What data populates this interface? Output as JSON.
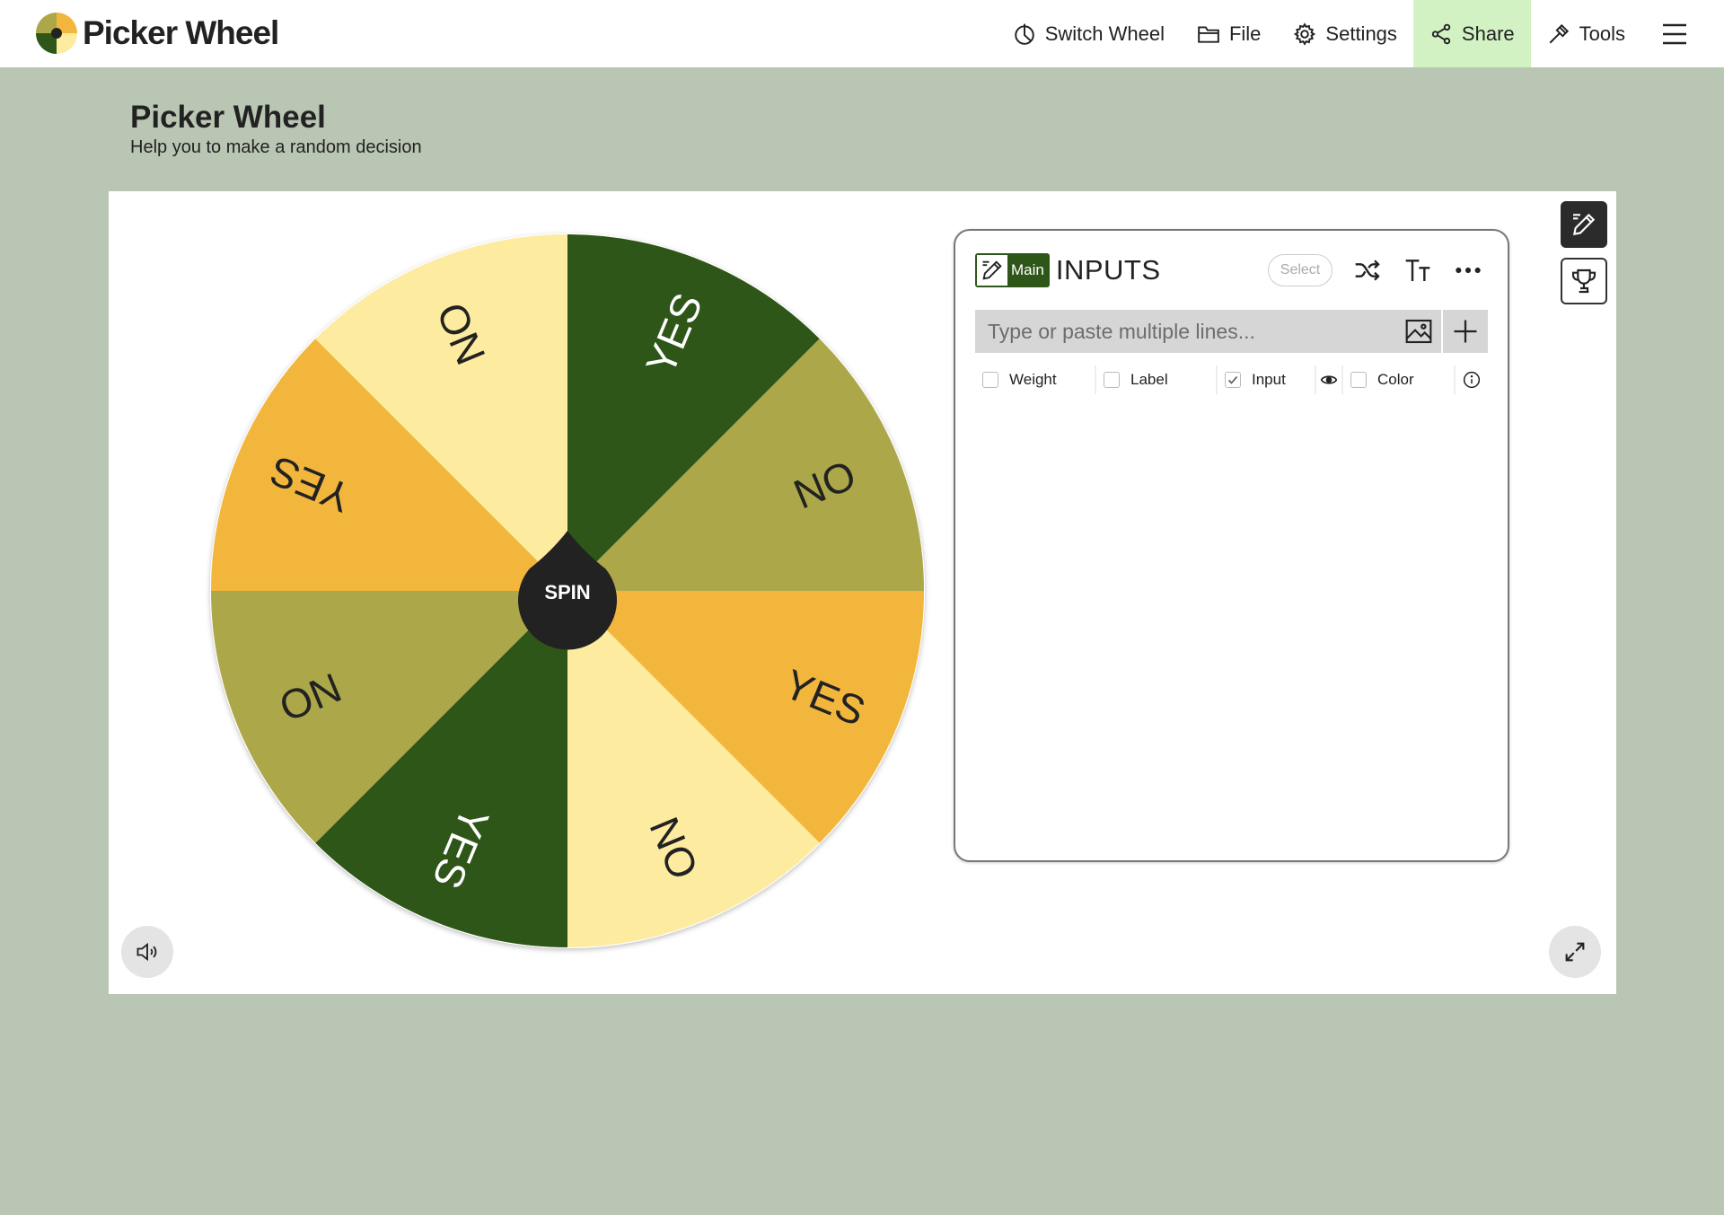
{
  "brand": {
    "name": "Picker Wheel"
  },
  "nav": {
    "items": [
      {
        "label": "Switch Wheel",
        "icon": "pie-chart-icon"
      },
      {
        "label": "File",
        "icon": "folder-icon"
      },
      {
        "label": "Settings",
        "icon": "gear-icon"
      },
      {
        "label": "Share",
        "icon": "share-icon"
      },
      {
        "label": "Tools",
        "icon": "hammer-icon"
      }
    ],
    "menu_icon": "hamburger-menu-icon",
    "share_highlight": "#d2f2c3"
  },
  "header": {
    "title": "Picker Wheel",
    "subtitle": "Help you to make a random decision"
  },
  "wheel": {
    "spin_label": "SPIN",
    "segments": [
      {
        "label": "YES",
        "color": "#2f5619",
        "text_color": "#ffffff"
      },
      {
        "label": "NO",
        "color": "#aca84a",
        "text_color": "#222222"
      },
      {
        "label": "YES",
        "color": "#f3b63d",
        "text_color": "#222222"
      },
      {
        "label": "NO",
        "color": "#fdeba0",
        "text_color": "#222222"
      },
      {
        "label": "YES",
        "color": "#2f5619",
        "text_color": "#ffffff"
      },
      {
        "label": "NO",
        "color": "#aca84a",
        "text_color": "#222222"
      },
      {
        "label": "YES",
        "color": "#f3b63d",
        "text_color": "#222222"
      },
      {
        "label": "NO",
        "color": "#fdeba0",
        "text_color": "#222222"
      }
    ]
  },
  "inputs_panel": {
    "badge_label": "Main",
    "title": "INPUTS",
    "select_label": "Select",
    "entry_placeholder": "Type or paste multiple lines...",
    "options": [
      {
        "label": "Weight",
        "checked": false
      },
      {
        "label": "Label",
        "checked": false
      },
      {
        "label": "Input",
        "checked": true
      },
      {
        "label": "Color",
        "checked": false
      }
    ]
  },
  "colors": {
    "background": "#b9c6b3",
    "accent_dark": "#2f5619",
    "spin_button": "#222222"
  }
}
